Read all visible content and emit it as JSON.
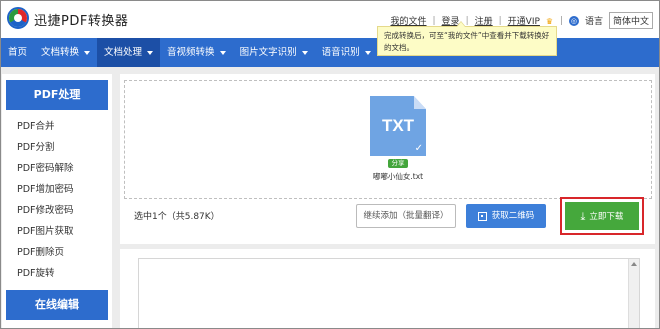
{
  "app": {
    "brand": "迅捷PDF转换器"
  },
  "toplinks": {
    "my_files": "我的文件",
    "login": "登录",
    "register": "注册",
    "vip": "开通VIP",
    "lang_label": "语言",
    "lang_value": "简体中文"
  },
  "nav": [
    {
      "label": "首页",
      "dropdown": false
    },
    {
      "label": "文档转换",
      "dropdown": true
    },
    {
      "label": "文档处理",
      "dropdown": true,
      "active": true
    },
    {
      "label": "音视频转换",
      "dropdown": true
    },
    {
      "label": "图片文字识别",
      "dropdown": true
    },
    {
      "label": "语音识别",
      "dropdown": true
    }
  ],
  "tooltip": {
    "text": "完成转换后，可至“我的文件”中查看并下载转换好的文档。"
  },
  "sidebar": {
    "section1": "PDF处理",
    "items": [
      "PDF合并",
      "PDF分割",
      "PDF密码解除",
      "PDF增加密码",
      "PDF修改密码",
      "PDF图片获取",
      "PDF删除页",
      "PDF旋转"
    ],
    "section2": "在线编辑"
  },
  "file": {
    "ext": "TXT",
    "share_label": "分享",
    "name": "嘟嘟小仙女.txt",
    "icon": "txt-file-icon"
  },
  "actions": {
    "count_text": "选中1个（共5.87K）",
    "continue_label": "继续添加（批量翻译）",
    "qr_label": "获取二维码",
    "download_label": "立即下载"
  },
  "colors": {
    "primary_blue": "#2d6ccd",
    "nav_active": "#1c4fa6",
    "download_green": "#45a83c",
    "highlight_red": "#d8262a",
    "tooltip_bg": "#fdfcc6"
  }
}
